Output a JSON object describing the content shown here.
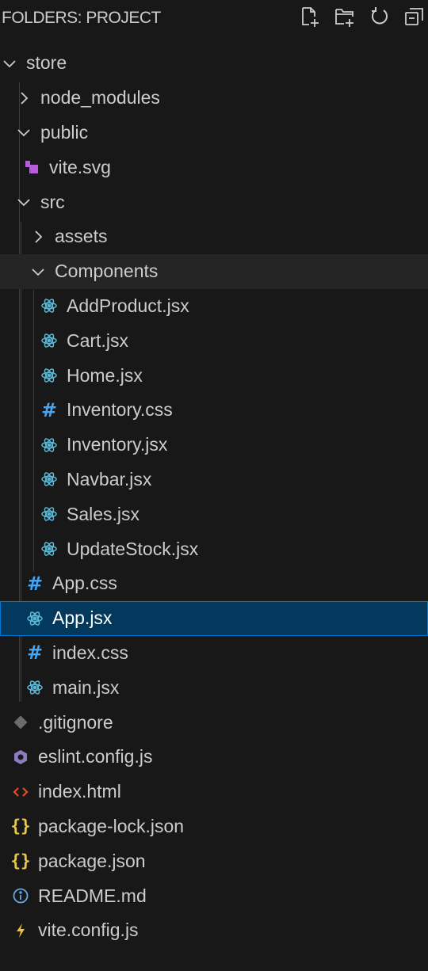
{
  "header": {
    "title": "FOLDERS: PROJECT",
    "actions": [
      "new-file-icon",
      "new-folder-icon",
      "refresh-icon",
      "collapse-all-icon"
    ]
  },
  "colors": {
    "background": "#181818",
    "selected_bg": "#04395e",
    "selected_border": "#0078d4",
    "react": "#5ab8d6",
    "css": "#42a5f5",
    "vite_svg": "#b95cdb",
    "git": "#6c6c6c",
    "eslint": "#8e7cc3",
    "html": "#e44d26",
    "json": "#e8c84b",
    "info": "#66a7e8",
    "vite": "#f0c13b"
  },
  "tree": [
    {
      "name": "store",
      "type": "folder",
      "expanded": true,
      "icon": "chevron-down-icon"
    },
    {
      "name": "node_modules",
      "type": "folder",
      "expanded": false,
      "icon": "chevron-right-icon"
    },
    {
      "name": "public",
      "type": "folder",
      "expanded": true,
      "icon": "chevron-down-icon"
    },
    {
      "name": "vite.svg",
      "type": "file",
      "icon": "svg-file-icon"
    },
    {
      "name": "src",
      "type": "folder",
      "expanded": true,
      "icon": "chevron-down-icon"
    },
    {
      "name": "assets",
      "type": "folder",
      "expanded": false,
      "icon": "chevron-right-icon"
    },
    {
      "name": "Components",
      "type": "folder",
      "expanded": true,
      "icon": "chevron-down-icon"
    },
    {
      "name": "AddProduct.jsx",
      "type": "file",
      "icon": "react-icon"
    },
    {
      "name": "Cart.jsx",
      "type": "file",
      "icon": "react-icon"
    },
    {
      "name": "Home.jsx",
      "type": "file",
      "icon": "react-icon"
    },
    {
      "name": "Inventory.css",
      "type": "file",
      "icon": "css-hash-icon"
    },
    {
      "name": "Inventory.jsx",
      "type": "file",
      "icon": "react-icon"
    },
    {
      "name": "Navbar.jsx",
      "type": "file",
      "icon": "react-icon"
    },
    {
      "name": "Sales.jsx",
      "type": "file",
      "icon": "react-icon"
    },
    {
      "name": "UpdateStock.jsx",
      "type": "file",
      "icon": "react-icon"
    },
    {
      "name": "App.css",
      "type": "file",
      "icon": "css-hash-icon"
    },
    {
      "name": "App.jsx",
      "type": "file",
      "icon": "react-icon"
    },
    {
      "name": "index.css",
      "type": "file",
      "icon": "css-hash-icon"
    },
    {
      "name": "main.jsx",
      "type": "file",
      "icon": "react-icon"
    },
    {
      "name": ".gitignore",
      "type": "file",
      "icon": "git-icon"
    },
    {
      "name": "eslint.config.js",
      "type": "file",
      "icon": "eslint-icon"
    },
    {
      "name": "index.html",
      "type": "file",
      "icon": "html-icon"
    },
    {
      "name": "package-lock.json",
      "type": "file",
      "icon": "json-icon"
    },
    {
      "name": "package.json",
      "type": "file",
      "icon": "json-icon"
    },
    {
      "name": "README.md",
      "type": "file",
      "icon": "info-icon"
    },
    {
      "name": "vite.config.js",
      "type": "file",
      "icon": "vite-icon"
    }
  ]
}
